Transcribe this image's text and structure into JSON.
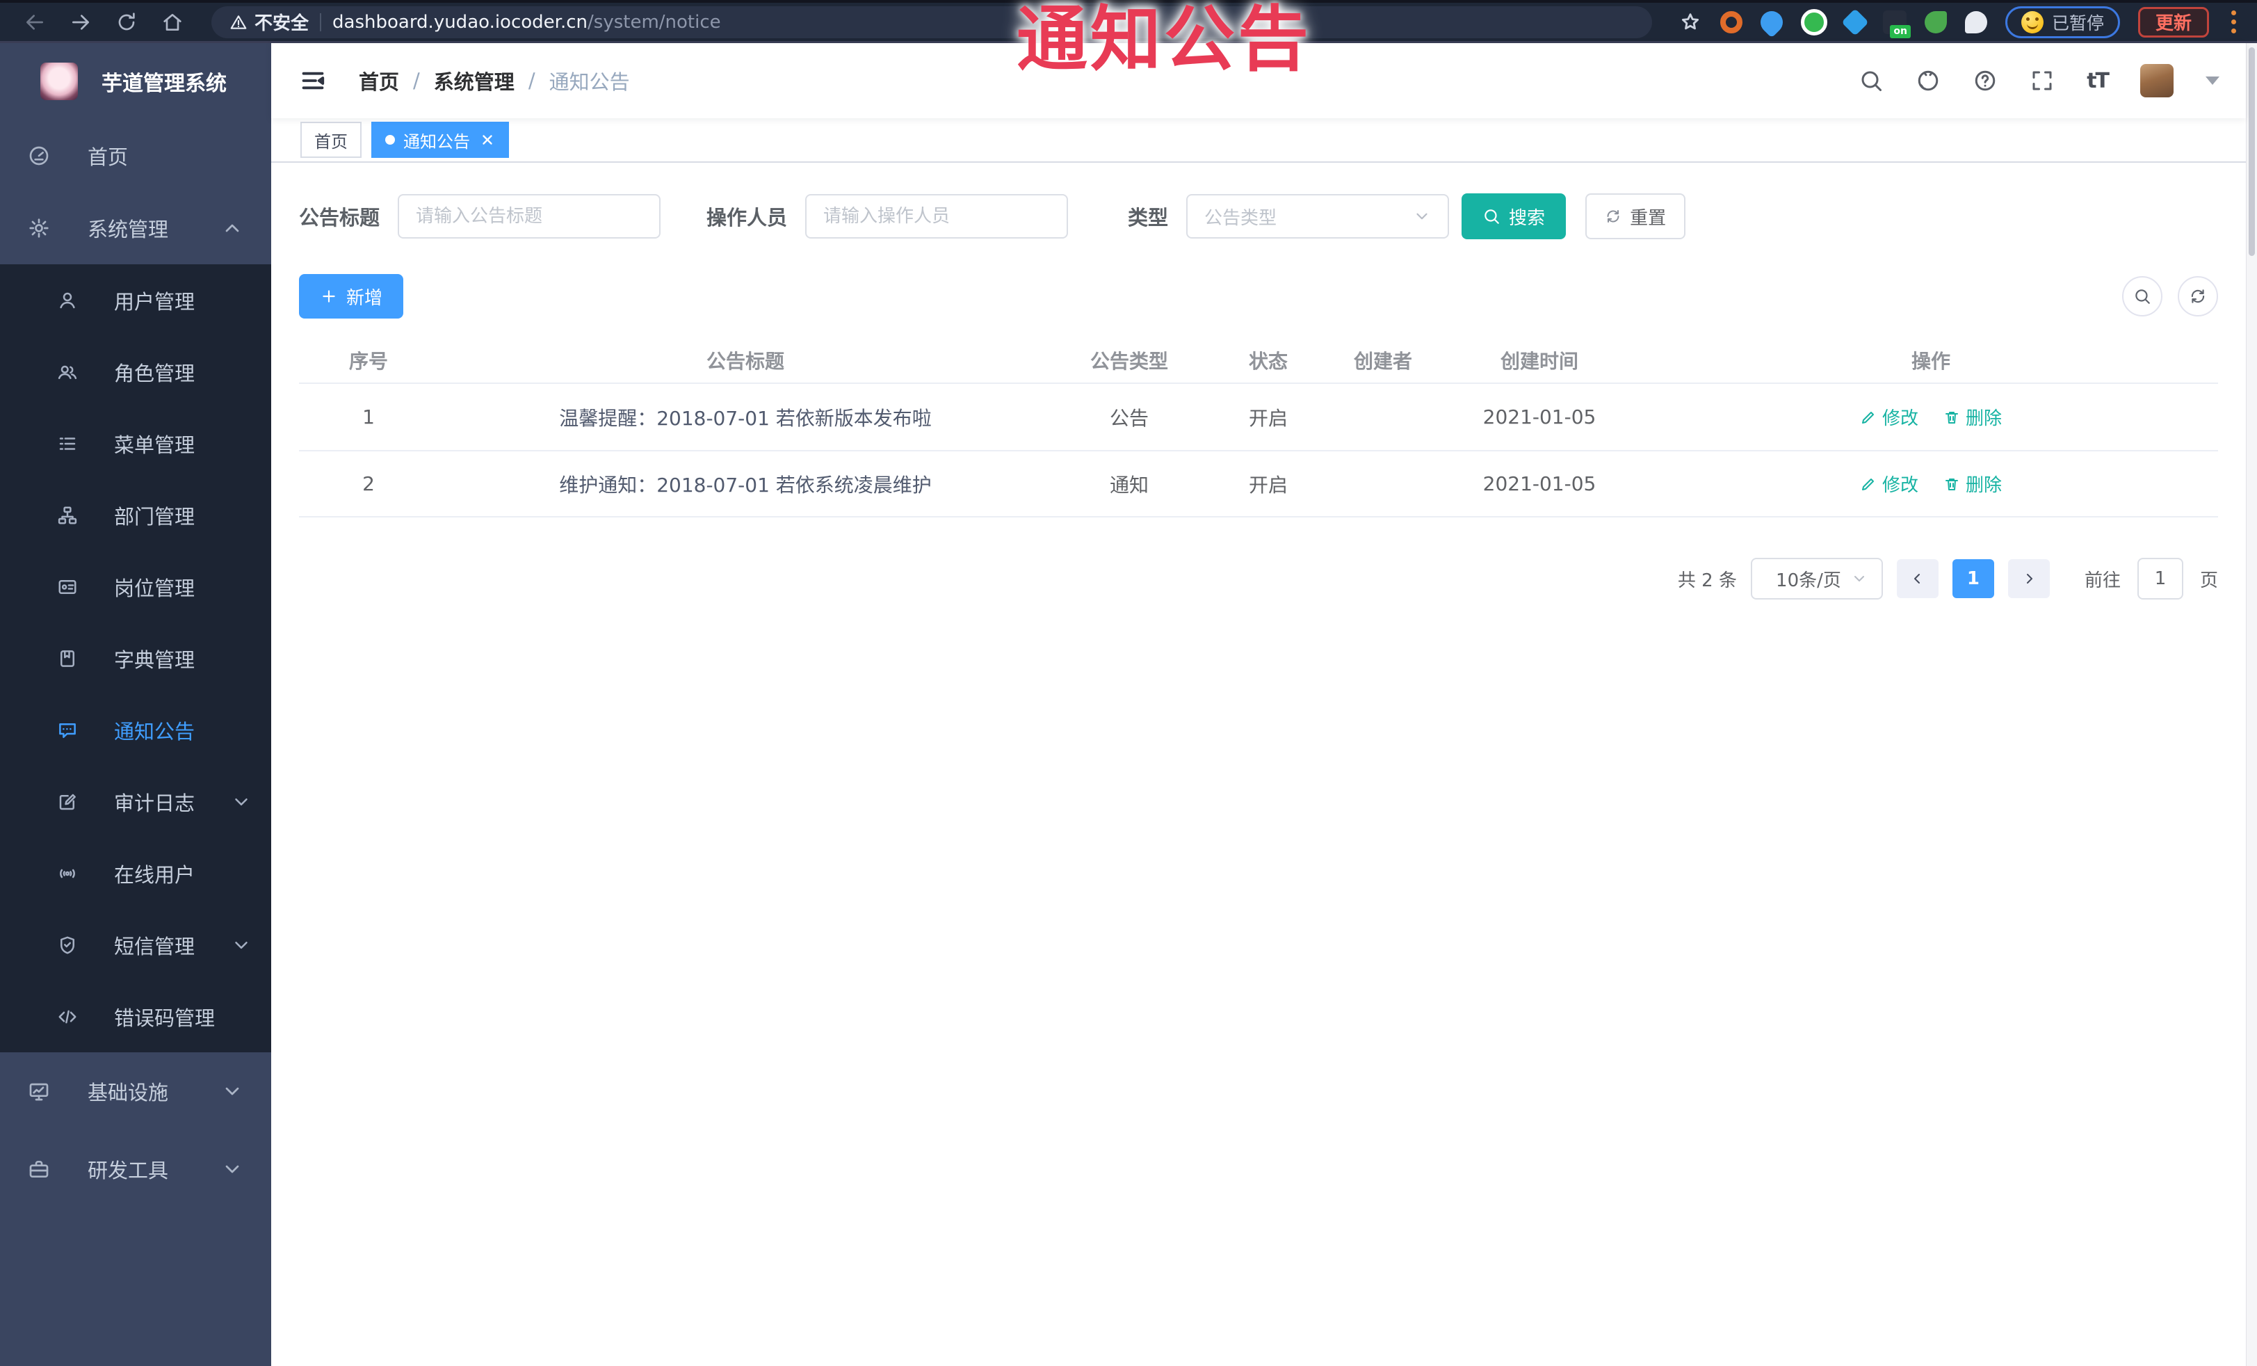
{
  "annotation": {
    "watermark": "通知公告"
  },
  "browser": {
    "security": "不安全",
    "host": "dashboard.yudao.iocoder.cn",
    "path": "/system/notice",
    "ext_badge": "on",
    "paused": "已暂停",
    "update": "更新"
  },
  "sidebar": {
    "title": "芋道管理系统",
    "items": [
      {
        "label": "首页"
      },
      {
        "label": "系统管理"
      },
      {
        "label": "用户管理"
      },
      {
        "label": "角色管理"
      },
      {
        "label": "菜单管理"
      },
      {
        "label": "部门管理"
      },
      {
        "label": "岗位管理"
      },
      {
        "label": "字典管理"
      },
      {
        "label": "通知公告"
      },
      {
        "label": "审计日志"
      },
      {
        "label": "在线用户"
      },
      {
        "label": "短信管理"
      },
      {
        "label": "错误码管理"
      },
      {
        "label": "基础设施"
      },
      {
        "label": "研发工具"
      }
    ]
  },
  "navbar": {
    "breadcrumb": {
      "home": "首页",
      "section": "系统管理",
      "current": "通知公告",
      "separator": "/"
    },
    "font_icon": "tT"
  },
  "tabs": {
    "home": "首页",
    "current": "通知公告"
  },
  "filters": {
    "title_label": "公告标题",
    "title_placeholder": "请输入公告标题",
    "operator_label": "操作人员",
    "operator_placeholder": "请输入操作人员",
    "type_label": "类型",
    "type_placeholder": "公告类型",
    "search": "搜索",
    "reset": "重置"
  },
  "toolbar": {
    "add": "新增"
  },
  "table": {
    "headers": {
      "no": "序号",
      "title": "公告标题",
      "type": "公告类型",
      "status": "状态",
      "creator": "创建者",
      "created": "创建时间",
      "ops": "操作"
    },
    "rows": [
      {
        "no": "1",
        "title": "温馨提醒：2018-07-01 若依新版本发布啦",
        "type": "公告",
        "status": "开启",
        "creator": "",
        "created": "2021-01-05",
        "edit": "修改",
        "delete": "删除"
      },
      {
        "no": "2",
        "title": "维护通知：2018-07-01 若依系统凌晨维护",
        "type": "通知",
        "status": "开启",
        "creator": "",
        "created": "2021-01-05",
        "edit": "修改",
        "delete": "删除"
      }
    ]
  },
  "pagination": {
    "total": "共 2 条",
    "page_size": "10条/页",
    "current": "1",
    "goto_label": "前往",
    "goto_value": "1",
    "page_label": "页"
  },
  "colors": {
    "accent": "#409eff",
    "teal": "#17b3a3",
    "watermark_red": "#e83b55",
    "sidebar_bg": "#3a4560",
    "submenu_bg": "#1c2433"
  }
}
